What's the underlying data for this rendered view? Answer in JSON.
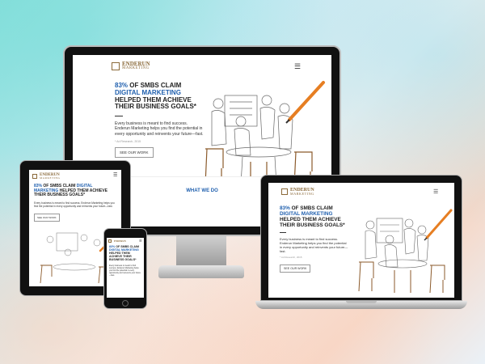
{
  "brand": {
    "name": "ENDERUN",
    "tagline": "MARKETING"
  },
  "hero": {
    "pct": "83%",
    "line1_rest": " OF SMBS CLAIM",
    "line2": "DIGITAL MARKETING",
    "line3": "HELPED THEM ACHIEVE",
    "line4": "THEIR BUSINESS GOALS*",
    "paragraph": "Every business is meant to find success. Enderun Marketing helps you find the potential in every opportunity and reinvents your future—fast.",
    "footnote": "* Ad Research, 2015",
    "cta": "SEE OUR WORK"
  },
  "sections": {
    "what_we_do": "WHAT WE DO"
  },
  "icons": {
    "menu": "hamburger-icon",
    "logo": "enderun-logo-icon",
    "pencil": "pencil-icon"
  },
  "colors": {
    "accent": "#1f5fae",
    "brand": "#8b6a3a",
    "pencil": "#e67e22"
  }
}
